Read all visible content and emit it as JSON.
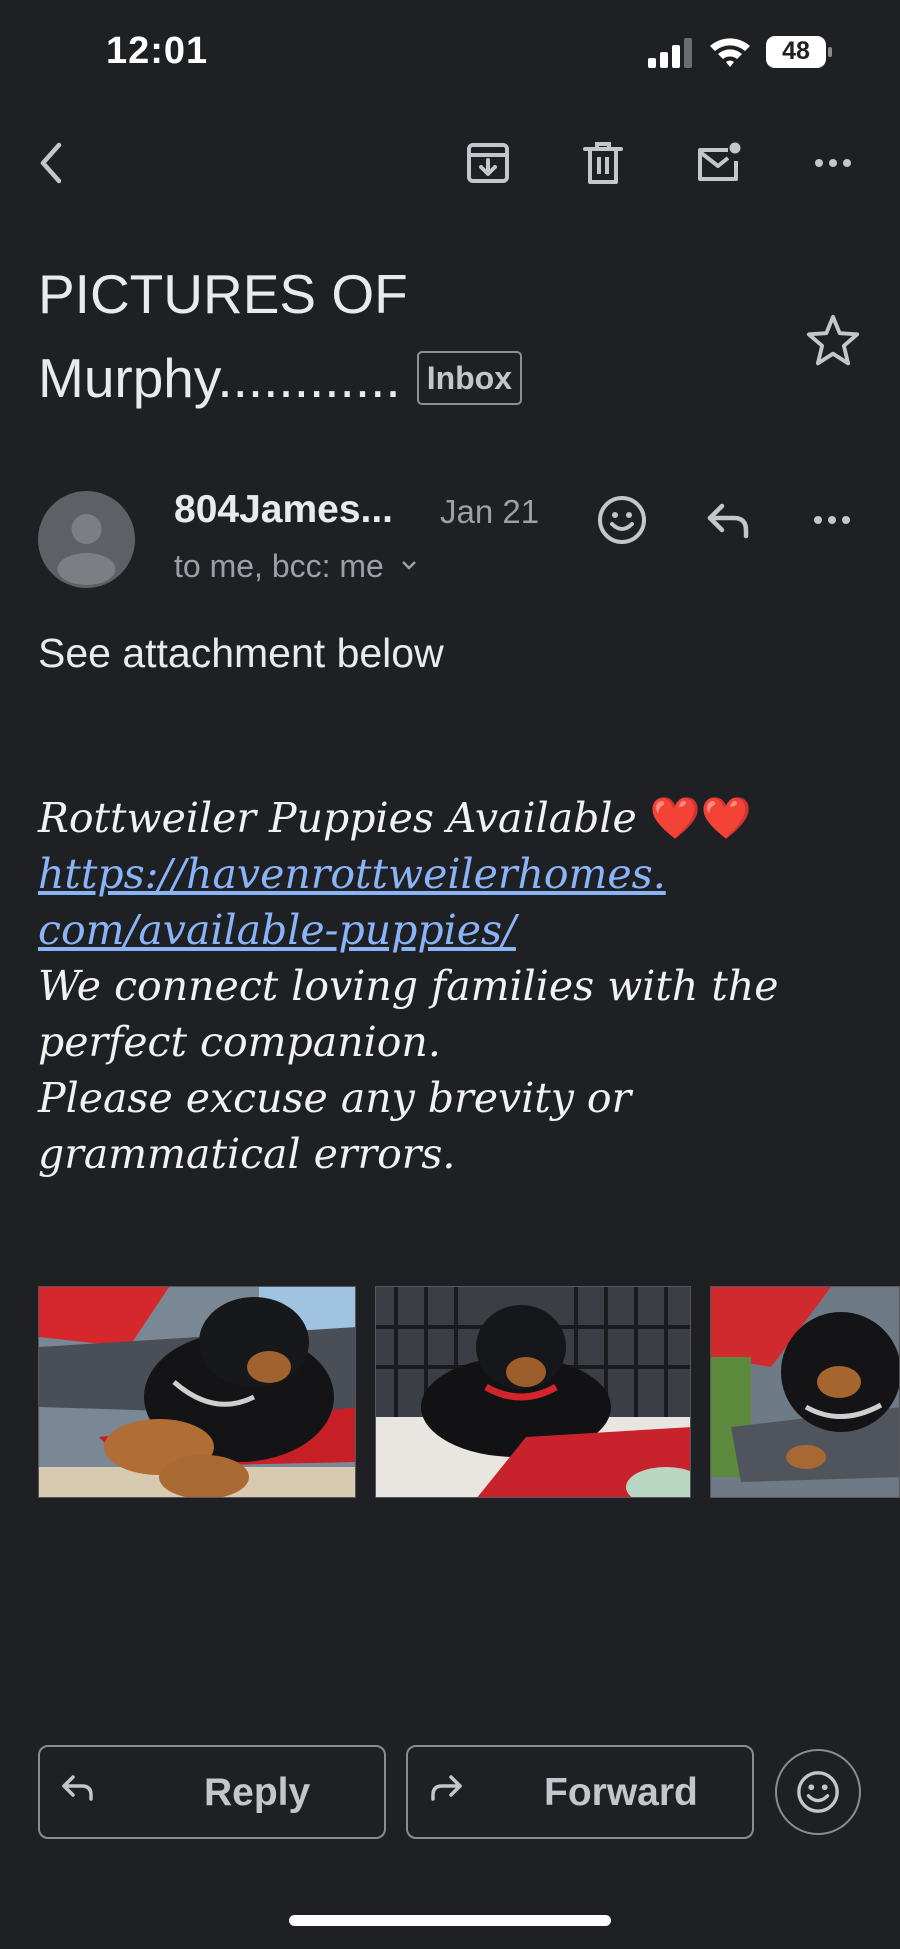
{
  "status_bar": {
    "time": "12:01",
    "battery": "48"
  },
  "toolbar": {
    "back_icon": "back-arrow-icon",
    "archive_icon": "archive-icon",
    "delete_icon": "trash-icon",
    "mark_unread_icon": "mark-unread-icon",
    "more_icon": "more-horizontal-icon"
  },
  "email": {
    "subject_line1": "PICTURES OF",
    "subject_line2": "Murphy............",
    "label": "Inbox",
    "sender": "804James...",
    "date": "Jan 21",
    "recipients": "to me, bcc: me",
    "intro": "See attachment below",
    "signature": {
      "line1": "Rottweiler Puppies Available",
      "hearts": "❤️❤️",
      "link_line1": "https://havenrottweilerhomes.",
      "link_line2": "com/available-puppies/",
      "line3": "We connect loving families with the",
      "line4": "perfect companion.",
      "line5": "Please excuse any brevity or",
      "line6": "grammatical errors."
    }
  },
  "attachments": [
    {
      "name": "puppy-photo-1",
      "icon": "image-thumbnail"
    },
    {
      "name": "puppy-photo-2",
      "icon": "image-thumbnail"
    },
    {
      "name": "puppy-photo-3",
      "icon": "image-thumbnail"
    }
  ],
  "actions": {
    "reply_label": "Reply",
    "forward_label": "Forward"
  },
  "colors": {
    "background": "#1f2024",
    "text_primary": "#e8eaed",
    "text_secondary": "#9aa0a6",
    "link": "#8ab4f8"
  }
}
